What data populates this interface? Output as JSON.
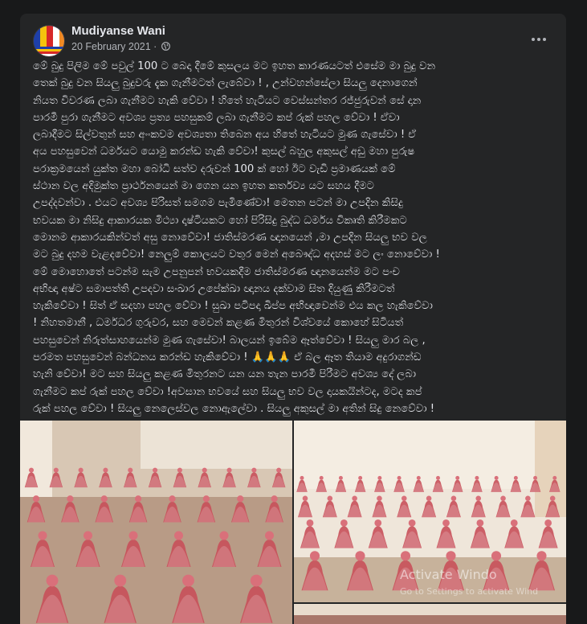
{
  "post": {
    "author": "Mudiyanse Wani",
    "date": "20 February 2021",
    "separator": "·",
    "privacy_icon": "globe-icon",
    "menu_icon": "more-options-icon",
    "text": "මේ බුදු පිලිම මේ පවුල් 100 ට බෙදා දීමේ කුසලය මට ඉහත කාරණයටත්  එසේම මා බුදු වන\nතෙක් බුදු වන සියලු බුදුවරු දැක ගැනීමටත්  ලැබේවා ! , උන්වහන්සේලා සියලු දෙනාගෙන්\nනියත විවරණ ලබා ගැනීමට හැකි වේවා  ! හිතේ හැටියට වෙස්සන්තර රජ්ජුරුවන් සේ දාන\nපාරමී පුරා ගැනීමට අවශ්‍ය ප්‍රත්‍ය පහසුකම් ලබා ගැනීමට කප් රුක් පහල වේවා ! ඒවා\nලබාදීමට සිල්වතුන් සහ අංංකවම අවශ්‍යතා තිබෙන අය  හිතේ හැටියට මුණ ගැසේවා ! ඒ\nඅය පහසුවෙන් ධර්මයට යොමු කරන්ඩ හැකි වේවා! කුසල් බහුල අකුසල් අඩු මහා පුරුෂ\nපරාක්‍රමයෙන්  යුක්ත මහා බෝධි සත්ව දරුවන් 100 ක් හෝ ඊට වැඩි ප්‍රමාණයක් මේ\nස්ථාන වල අදිමුක්ත ප්‍රාර්ථනයෙන් මා ගෙන යන ඉහත කර්තව්‍ය යට සහය දීමට\nඋපද්දවන්වා . එයට අවශ්‍ය පිරිසත් සමගම පැමිණේවා! මෙතන පටන් මා උපදින කිසිදු\nභවයක මා නිසිදු ආකාරයක මි‍ථ්‍යා  දෘෂ්ටියකට හෝ පිරිසිදු බුද්ධ ධර්මය විකෘති කිරීමකට\nමොනම ආකාරයකින්වත් අසු නොවේවා! ජාතිස්මරණ ඥානයෙන් ,මා උපදින සියලු භව වල\nමට බුදු දහම වැළදවේවා! නෙලුම් කොලයට වතුර මෙන් අබෞද්ධ අදහස් මට ලං නොවේවා !\nමේ මොහොතේ පටන්ම සැම උපනුපන් භවයකදීම ජාතිස්මරණ  ඥානයෙන්ම මට පංච\nඅභිඥා අෂ්ට සමාපත්ති උපදවා සංඛාර උපේක්ඛා ඥානය දක්වාම සිත දියුණු කිරීමටත්\nහැකිවේවා ! සිත් ඒ සදහා පහල වේවා ! සුඛා පටිපදා ඛිප්ප අභිඥාවෙන්ම එය කල හැකිවේවා\n! නිහතමානී , ධර්මධර ගුරුවර, සහ මෙවන් කළණ මිතුරන් විශ්වයේ කොහේ සිටියත්\nපහසුවෙන් නිරුත්සාහයෙන්ම මුණ ගැසේවා! බාලයන් ඉබේම ඈත්වේවා ! සියලු මාර බල ,\nපරමත පහසුවෙන් බන්ධනය කරන්ඩ හැකිවේවා ! 🙏🙏🙏 ඒ බල ඈත තියාම අදුරාගන්ඩ\nහැනි වේවා! මට සහ සියලු කළණ මිතුරනට යන යන තැන පාරමී පිරීමට අවශ්‍ය දේ ලබා\nගැනීමට කප් රුක් පහල වේවා !අවසාන භවයේ සහ සියලු භව වල දායකයින්ටද, මටද  කප්\nරුක් පහල වේවා ! සියලු නෙලෙස්වල නොඇලේවා . සියලු අකුසල් මා අතින් සිදු නෙවේවා !"
  },
  "overlay": {
    "line1": "Activate Windo",
    "line2": "Go to Settings to activate Wind"
  },
  "colors": {
    "card_bg": "#242526",
    "page_bg": "#18191a",
    "text": "#e4e6eb",
    "secondary": "#b0b3b8",
    "statue_red": "#c8505a"
  }
}
